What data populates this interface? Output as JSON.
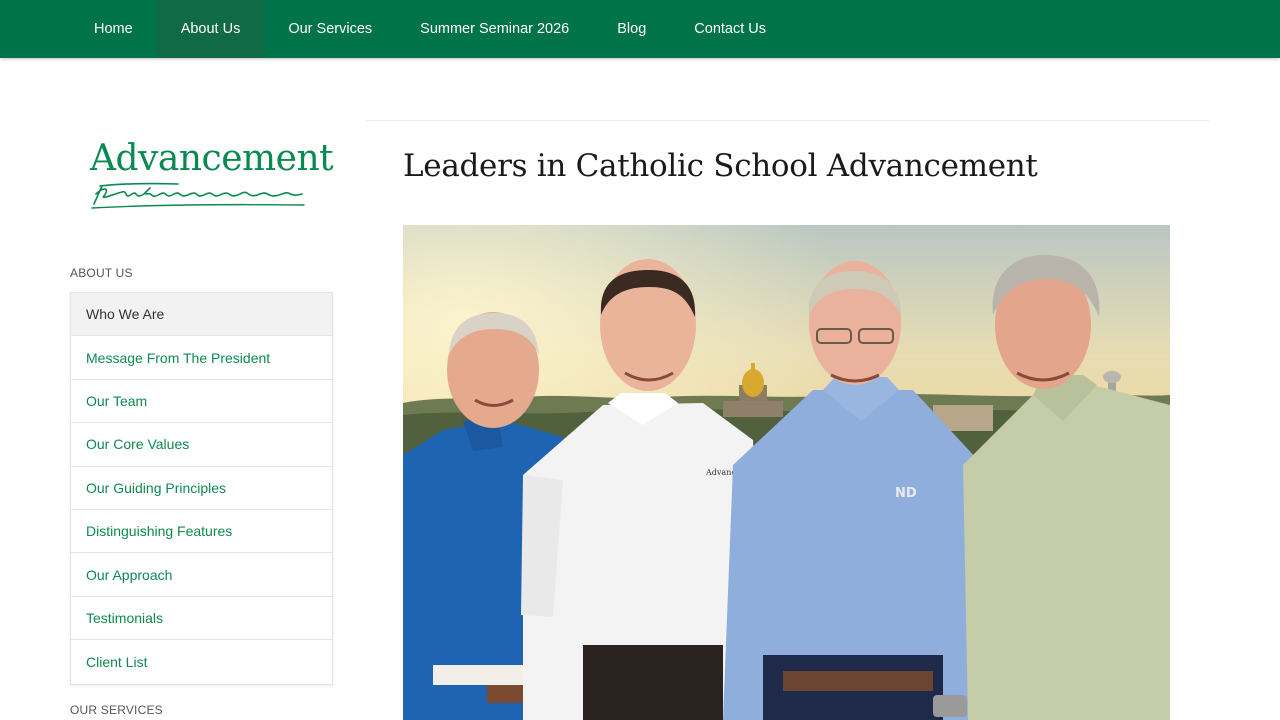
{
  "nav": {
    "items": [
      {
        "label": "Home",
        "active": false
      },
      {
        "label": "About Us",
        "active": true
      },
      {
        "label": "Our Services",
        "active": false
      },
      {
        "label": "Summer Seminar 2026",
        "active": false
      },
      {
        "label": "Blog",
        "active": false
      },
      {
        "label": "Contact Us",
        "active": false
      }
    ]
  },
  "logo": {
    "word": "Advancement",
    "script": "partners"
  },
  "sidebar": {
    "about_heading": "ABOUT US",
    "items": [
      {
        "label": "Who We Are",
        "current": true
      },
      {
        "label": "Message From The President",
        "current": false
      },
      {
        "label": "Our Team",
        "current": false
      },
      {
        "label": "Our Core Values",
        "current": false
      },
      {
        "label": "Our Guiding Principles",
        "current": false
      },
      {
        "label": "Distinguishing Features",
        "current": false
      },
      {
        "label": "Our Approach",
        "current": false
      },
      {
        "label": "Testimonials",
        "current": false
      },
      {
        "label": "Client List",
        "current": false
      }
    ],
    "services_heading": "OUR SERVICES"
  },
  "main": {
    "title": "Leaders in Catholic School Advancement",
    "shirt_badge": "ND"
  },
  "colors": {
    "brand_green": "#00734a",
    "link_green": "#0e8a4f"
  }
}
